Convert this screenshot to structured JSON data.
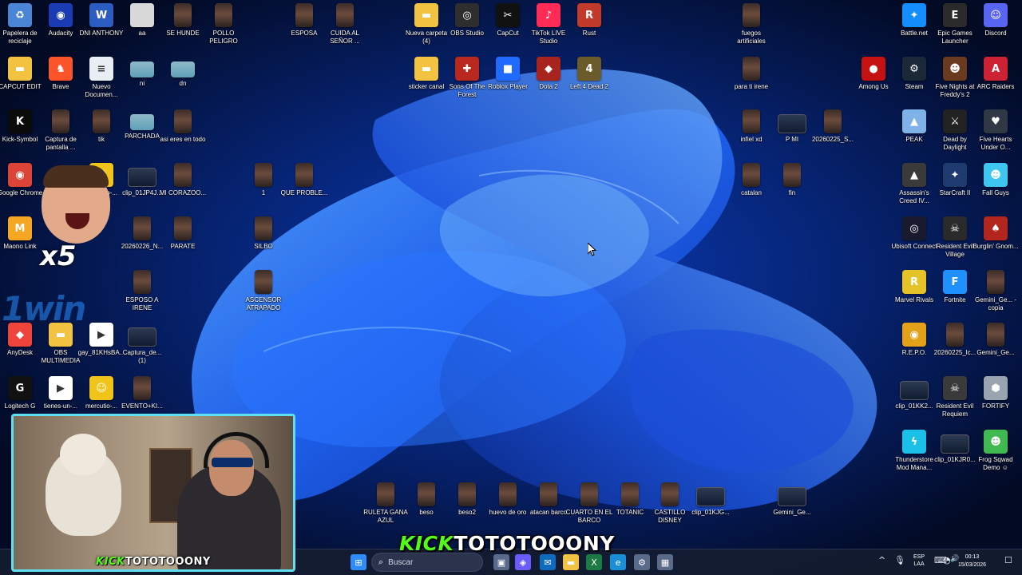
{
  "desktop_icons": [
    {
      "label": "Papelera de reciclaje",
      "icon": "recycle-bin-icon",
      "glyph": "♻",
      "color": "#4b86d6",
      "col": 0,
      "row": 0
    },
    {
      "label": "Audacity",
      "icon": "audacity-icon",
      "glyph": "◉",
      "color": "#1b3bb5",
      "col": 1,
      "row": 0
    },
    {
      "label": "DNI ANTHONY",
      "icon": "word-document-icon",
      "glyph": "W",
      "color": "#2b5cc2",
      "col": 2,
      "row": 0
    },
    {
      "label": "aa",
      "icon": "image-file-icon",
      "glyph": "",
      "color": "#d8d8d8",
      "col": 3,
      "row": 0
    },
    {
      "label": "SE HUNDE",
      "icon": "video-thumbnail-icon",
      "glyph": "",
      "color": "thumb",
      "col": 4,
      "row": 0
    },
    {
      "label": "POLLO PELIGRO",
      "icon": "video-thumbnail-icon",
      "glyph": "",
      "color": "thumb",
      "col": 5,
      "row": 0
    },
    {
      "label": "ESPOSA",
      "icon": "video-thumbnail-icon",
      "glyph": "",
      "color": "thumb",
      "col": 7,
      "row": 0
    },
    {
      "label": "CUIDA AL SEÑOR ...",
      "icon": "video-thumbnail-icon",
      "glyph": "",
      "color": "thumb",
      "col": 8,
      "row": 0
    },
    {
      "label": "Nueva carpeta (4)",
      "icon": "folder-icon",
      "glyph": "▬",
      "color": "#f2c340",
      "col": 10,
      "row": 0
    },
    {
      "label": "OBS Studio",
      "icon": "obs-studio-icon",
      "glyph": "◎",
      "color": "#2e2e2e",
      "col": 11,
      "row": 0
    },
    {
      "label": "CapCut",
      "icon": "capcut-icon",
      "glyph": "✂",
      "color": "#111111",
      "col": 12,
      "row": 0
    },
    {
      "label": "TikTok LIVE Studio",
      "icon": "tiktok-live-icon",
      "glyph": "♪",
      "color": "#fe2c55",
      "col": 13,
      "row": 0
    },
    {
      "label": "Rust",
      "icon": "rust-game-icon",
      "glyph": "R",
      "color": "#c23a2a",
      "col": 14,
      "row": 0
    },
    {
      "label": "fuegos artificiales",
      "icon": "video-thumbnail-icon",
      "glyph": "",
      "color": "thumb",
      "col": 18,
      "row": 0
    },
    {
      "label": "Battle.net",
      "icon": "battlenet-icon",
      "glyph": "✦",
      "color": "#148eff",
      "col": 22,
      "row": 0
    },
    {
      "label": "Epic Games Launcher",
      "icon": "epic-games-icon",
      "glyph": "E",
      "color": "#2a2a2a",
      "col": 23,
      "row": 0
    },
    {
      "label": "Discord",
      "icon": "discord-icon",
      "glyph": "☺",
      "color": "#5865f2",
      "col": 24,
      "row": 0
    },
    {
      "label": "CAPCUT EDIT",
      "icon": "folder-icon",
      "glyph": "▬",
      "color": "#f2c340",
      "col": 0,
      "row": 1
    },
    {
      "label": "Brave",
      "icon": "brave-browser-icon",
      "glyph": "♞",
      "color": "#fb542b",
      "col": 1,
      "row": 1
    },
    {
      "label": "Nuevo Documen...",
      "icon": "text-document-icon",
      "glyph": "≡",
      "color": "#e9eef5",
      "col": 2,
      "row": 1
    },
    {
      "label": "ni",
      "icon": "image-file-icon",
      "glyph": "",
      "color": "thumb2",
      "col": 3,
      "row": 1
    },
    {
      "label": "dn",
      "icon": "image-file-icon",
      "glyph": "",
      "color": "thumb2",
      "col": 4,
      "row": 1
    },
    {
      "label": "sticker canal",
      "icon": "folder-icon",
      "glyph": "▬",
      "color": "#f2c340",
      "col": 10,
      "row": 1
    },
    {
      "label": "Sons Of The Forest",
      "icon": "sons-of-the-forest-icon",
      "glyph": "✚",
      "color": "#b8281e",
      "col": 11,
      "row": 1
    },
    {
      "label": "Roblox Player",
      "icon": "roblox-icon",
      "glyph": "■",
      "color": "#1f6bff",
      "col": 12,
      "row": 1
    },
    {
      "label": "Dota 2",
      "icon": "dota2-icon",
      "glyph": "◆",
      "color": "#a8241e",
      "col": 13,
      "row": 1
    },
    {
      "label": "Left 4 Dead 2",
      "icon": "left4dead2-icon",
      "glyph": "4",
      "color": "#6b5a2a",
      "col": 14,
      "row": 1
    },
    {
      "label": "para ti irene",
      "icon": "video-thumbnail-icon",
      "glyph": "",
      "color": "thumb",
      "col": 18,
      "row": 1
    },
    {
      "label": "Among Us",
      "icon": "among-us-icon",
      "glyph": "●",
      "color": "#c51111",
      "col": 21,
      "row": 1
    },
    {
      "label": "Steam",
      "icon": "steam-icon",
      "glyph": "⚙",
      "color": "#1b2838",
      "col": 22,
      "row": 1
    },
    {
      "label": "Five Nights at Freddy's 2",
      "icon": "fnaf2-icon",
      "glyph": "☻",
      "color": "#6a3a1e",
      "col": 23,
      "row": 1
    },
    {
      "label": "ARC Raiders",
      "icon": "arc-raiders-icon",
      "glyph": "A",
      "color": "#cc2233",
      "col": 24,
      "row": 1
    },
    {
      "label": "Kick-Symbol",
      "icon": "kick-icon",
      "glyph": "K",
      "color": "#0b0b0b",
      "col": 0,
      "row": 2
    },
    {
      "label": "Captura de pantalla ...",
      "icon": "screenshot-file-icon",
      "glyph": "",
      "color": "thumb",
      "col": 1,
      "row": 2
    },
    {
      "label": "tik",
      "icon": "video-thumbnail-icon",
      "glyph": "",
      "color": "thumb",
      "col": 2,
      "row": 2
    },
    {
      "label": "PARCHADA",
      "icon": "image-file-icon",
      "glyph": "",
      "color": "thumb2",
      "col": 3,
      "row": 2
    },
    {
      "label": "asi eres en todo",
      "icon": "video-thumbnail-icon",
      "glyph": "",
      "color": "thumb",
      "col": 4,
      "row": 2
    },
    {
      "label": "infiel xd",
      "icon": "video-thumbnail-icon",
      "glyph": "",
      "color": "thumb",
      "col": 18,
      "row": 2
    },
    {
      "label": "P MI",
      "icon": "video-thumbnail-icon",
      "glyph": "",
      "color": "wide",
      "col": 19,
      "row": 2
    },
    {
      "label": "20260225_S...",
      "icon": "video-thumbnail-icon",
      "glyph": "",
      "color": "thumb",
      "col": 20,
      "row": 2
    },
    {
      "label": "PEAK",
      "icon": "peak-game-icon",
      "glyph": "▲",
      "color": "#7fb2e6",
      "col": 22,
      "row": 2
    },
    {
      "label": "Dead by Daylight",
      "icon": "dead-by-daylight-icon",
      "glyph": "⚔",
      "color": "#222222",
      "col": 23,
      "row": 2
    },
    {
      "label": "Five Hearts Under O...",
      "icon": "five-hearts-icon",
      "glyph": "♥",
      "color": "#303845",
      "col": 24,
      "row": 2
    },
    {
      "label": "Google Chrome",
      "icon": "chrome-icon",
      "glyph": "◉",
      "color": "#db4437",
      "col": 0,
      "row": 3
    },
    {
      "label": "mercutio-...",
      "icon": "sticker-file-icon",
      "glyph": "☺",
      "color": "#f0c419",
      "col": 2,
      "row": 3
    },
    {
      "label": "clip_01JP4J...",
      "icon": "video-clip-icon",
      "glyph": "",
      "color": "wide",
      "col": 3,
      "row": 3
    },
    {
      "label": "MI CORAZOO...",
      "icon": "video-thumbnail-icon",
      "glyph": "",
      "color": "thumb",
      "col": 4,
      "row": 3
    },
    {
      "label": "1",
      "icon": "video-thumbnail-icon",
      "glyph": "",
      "color": "thumb",
      "col": 6,
      "row": 3
    },
    {
      "label": "QUE PROBLE...",
      "icon": "video-thumbnail-icon",
      "glyph": "",
      "color": "thumb",
      "col": 7,
      "row": 3
    },
    {
      "label": "catalan",
      "icon": "video-thumbnail-icon",
      "glyph": "",
      "color": "thumb",
      "col": 18,
      "row": 3
    },
    {
      "label": "fin",
      "icon": "video-thumbnail-icon",
      "glyph": "",
      "color": "thumb",
      "col": 19,
      "row": 3
    },
    {
      "label": "Assassin's Creed IV...",
      "icon": "assassins-creed-icon",
      "glyph": "▲",
      "color": "#3a3a3a",
      "col": 22,
      "row": 3
    },
    {
      "label": "StarCraft II",
      "icon": "starcraft2-icon",
      "glyph": "✦",
      "color": "#1e3a6e",
      "col": 23,
      "row": 3
    },
    {
      "label": "Fall Guys",
      "icon": "fall-guys-icon",
      "glyph": "☻",
      "color": "#3ec6f0",
      "col": 24,
      "row": 3
    },
    {
      "label": "Maono Link",
      "icon": "maono-link-icon",
      "glyph": "M",
      "color": "#f5a623",
      "col": 0,
      "row": 4
    },
    {
      "label": "20260226_N...",
      "icon": "video-thumbnail-icon",
      "glyph": "",
      "color": "thumb",
      "col": 3,
      "row": 4
    },
    {
      "label": "PARATE",
      "icon": "video-thumbnail-icon",
      "glyph": "",
      "color": "thumb",
      "col": 4,
      "row": 4
    },
    {
      "label": "SILBO",
      "icon": "video-thumbnail-icon",
      "glyph": "",
      "color": "thumb",
      "col": 6,
      "row": 4
    },
    {
      "label": "Ubisoft Connect",
      "icon": "ubisoft-connect-icon",
      "glyph": "◎",
      "color": "#1a1a2e",
      "col": 22,
      "row": 4
    },
    {
      "label": "Resident Evil Village",
      "icon": "resident-evil-village-icon",
      "glyph": "☠",
      "color": "#2a2a2a",
      "col": 23,
      "row": 4
    },
    {
      "label": "Burglin' Gnom...",
      "icon": "burglin-gnomes-icon",
      "glyph": "♠",
      "color": "#b3261e",
      "col": 24,
      "row": 4
    },
    {
      "label": "ESPOSO A IRENE",
      "icon": "video-thumbnail-icon",
      "glyph": "",
      "color": "thumb",
      "col": 3,
      "row": 5
    },
    {
      "label": "ASCENSOR ATRAPADO",
      "icon": "video-thumbnail-icon",
      "glyph": "",
      "color": "thumb",
      "col": 6,
      "row": 5
    },
    {
      "label": "Marvel Rivals",
      "icon": "marvel-rivals-icon",
      "glyph": "R",
      "color": "#e6c229",
      "col": 22,
      "row": 5
    },
    {
      "label": "Fortnite",
      "icon": "fortnite-icon",
      "glyph": "F",
      "color": "#1e90ff",
      "col": 23,
      "row": 5
    },
    {
      "label": "Gemini_Ge... - copia",
      "icon": "image-file-icon",
      "glyph": "",
      "color": "thumb",
      "col": 24,
      "row": 5
    },
    {
      "label": "AnyDesk",
      "icon": "anydesk-icon",
      "glyph": "◆",
      "color": "#ef443b",
      "col": 0,
      "row": 6
    },
    {
      "label": "OBS MULTIMEDIA",
      "icon": "folder-icon",
      "glyph": "▬",
      "color": "#f2c340",
      "col": 1,
      "row": 6
    },
    {
      "label": "gay_81KHsBA...",
      "icon": "video-file-icon",
      "glyph": "▶",
      "color": "#ffffff",
      "col": 2,
      "row": 6
    },
    {
      "label": "Captura_de... (1)",
      "icon": "screenshot-file-icon",
      "glyph": "",
      "color": "wide",
      "col": 3,
      "row": 6
    },
    {
      "label": "R.E.P.O.",
      "icon": "repo-game-icon",
      "glyph": "◉",
      "color": "#e3a11a",
      "col": 22,
      "row": 6
    },
    {
      "label": "20260225_lc...",
      "icon": "video-thumbnail-icon",
      "glyph": "",
      "color": "thumb",
      "col": 23,
      "row": 6
    },
    {
      "label": "Gemini_Ge...",
      "icon": "image-file-icon",
      "glyph": "",
      "color": "thumb",
      "col": 24,
      "row": 6
    },
    {
      "label": "Logitech G",
      "icon": "logitech-g-icon",
      "glyph": "G",
      "color": "#111111",
      "col": 0,
      "row": 7
    },
    {
      "label": "tienes-un-...",
      "icon": "video-file-icon",
      "glyph": "▶",
      "color": "#ffffff",
      "col": 1,
      "row": 7
    },
    {
      "label": "mercutio-...",
      "icon": "sticker-file-icon",
      "glyph": "☺",
      "color": "#f0c419",
      "col": 2,
      "row": 7
    },
    {
      "label": "EVENTO+KI...",
      "icon": "video-thumbnail-icon",
      "glyph": "",
      "color": "thumb",
      "col": 3,
      "row": 7
    },
    {
      "label": "clip_01KK2...",
      "icon": "video-clip-icon",
      "glyph": "",
      "color": "wide",
      "col": 22,
      "row": 7
    },
    {
      "label": "Resident Evil Requiem",
      "icon": "resident-evil-requiem-icon",
      "glyph": "☠",
      "color": "#3a3a3a",
      "col": 23,
      "row": 7
    },
    {
      "label": "FORTIFY",
      "icon": "fortify-icon",
      "glyph": "⬢",
      "color": "#9aa4b0",
      "col": 24,
      "row": 7
    },
    {
      "label": "Thunderstore Mod Mana...",
      "icon": "thunderstore-icon",
      "glyph": "ϟ",
      "color": "#1ac0e8",
      "col": 22,
      "row": 8
    },
    {
      "label": "clip_01KJR0...",
      "icon": "video-clip-icon",
      "glyph": "",
      "color": "wide",
      "col": 23,
      "row": 8
    },
    {
      "label": "Frog Sqwad Demo ☺",
      "icon": "frog-sqwad-icon",
      "glyph": "☻",
      "color": "#3fb950",
      "col": 24,
      "row": 8
    },
    {
      "label": "RULETA GANA AZUL",
      "icon": "video-thumbnail-icon",
      "glyph": "",
      "color": "thumb",
      "col": 9,
      "row": 9
    },
    {
      "label": "beso",
      "icon": "video-thumbnail-icon",
      "glyph": "",
      "color": "thumb",
      "col": 10,
      "row": 9
    },
    {
      "label": "beso2",
      "icon": "video-thumbnail-icon",
      "glyph": "",
      "color": "thumb",
      "col": 11,
      "row": 9
    },
    {
      "label": "huevo de oro",
      "icon": "video-thumbnail-icon",
      "glyph": "",
      "color": "thumb",
      "col": 12,
      "row": 9
    },
    {
      "label": "atacan barco",
      "icon": "video-thumbnail-icon",
      "glyph": "",
      "color": "thumb",
      "col": 13,
      "row": 9
    },
    {
      "label": "CUARTO EN EL BARCO",
      "icon": "video-thumbnail-icon",
      "glyph": "",
      "color": "thumb",
      "col": 14,
      "row": 9
    },
    {
      "label": "TOTANIC",
      "icon": "video-thumbnail-icon",
      "glyph": "",
      "color": "thumb",
      "col": 15,
      "row": 9
    },
    {
      "label": "CASTILLO DISNEY",
      "icon": "video-thumbnail-icon",
      "glyph": "",
      "color": "thumb",
      "col": 16,
      "row": 9
    },
    {
      "label": "clip_01KJG...",
      "icon": "video-clip-icon",
      "glyph": "",
      "color": "wide",
      "col": 17,
      "row": 9
    },
    {
      "label": "Gemini_Ge...",
      "icon": "image-file-icon",
      "glyph": "",
      "color": "wide",
      "col": 19,
      "row": 9
    }
  ],
  "overlays": {
    "reaction_multiplier": "x5",
    "watermark": "1win",
    "kick_banner_brand": "KICK",
    "kick_banner_name": "TOTOTOOONY",
    "webcam_caption_brand": "KICK",
    "webcam_caption_name": "TOTOTOOONY"
  },
  "taskbar": {
    "search_placeholder": "Buscar",
    "pinned": [
      {
        "name": "start-button",
        "glyph": "⊞",
        "color": "#2f8cff"
      },
      {
        "name": "widgets-icon",
        "glyph": "☼",
        "color": "#c8a46a"
      },
      {
        "name": "task-view-icon",
        "glyph": "▣",
        "color": "#5a6a8a"
      },
      {
        "name": "copilot-icon",
        "glyph": "◈",
        "color": "#6a5cff"
      },
      {
        "name": "outlook-icon",
        "glyph": "✉",
        "color": "#0f6cbd"
      },
      {
        "name": "file-explorer-icon",
        "glyph": "▬",
        "color": "#f2c340"
      },
      {
        "name": "excel-icon",
        "glyph": "X",
        "color": "#1d7a44"
      },
      {
        "name": "edge-icon",
        "glyph": "e",
        "color": "#1a8fd6"
      },
      {
        "name": "settings-icon",
        "glyph": "⚙",
        "color": "#5a6a8a"
      },
      {
        "name": "calculator-icon",
        "glyph": "▦",
        "color": "#5a6a8a"
      }
    ],
    "tray": {
      "chevron": "^",
      "mic": "🎙",
      "lang_line1": "ESP",
      "lang_line2": "LAA",
      "net": "⌨",
      "wifi": "◔",
      "volume": "🔊",
      "time": "00:13",
      "date": "15/03/2026",
      "notifications": "☐"
    }
  }
}
